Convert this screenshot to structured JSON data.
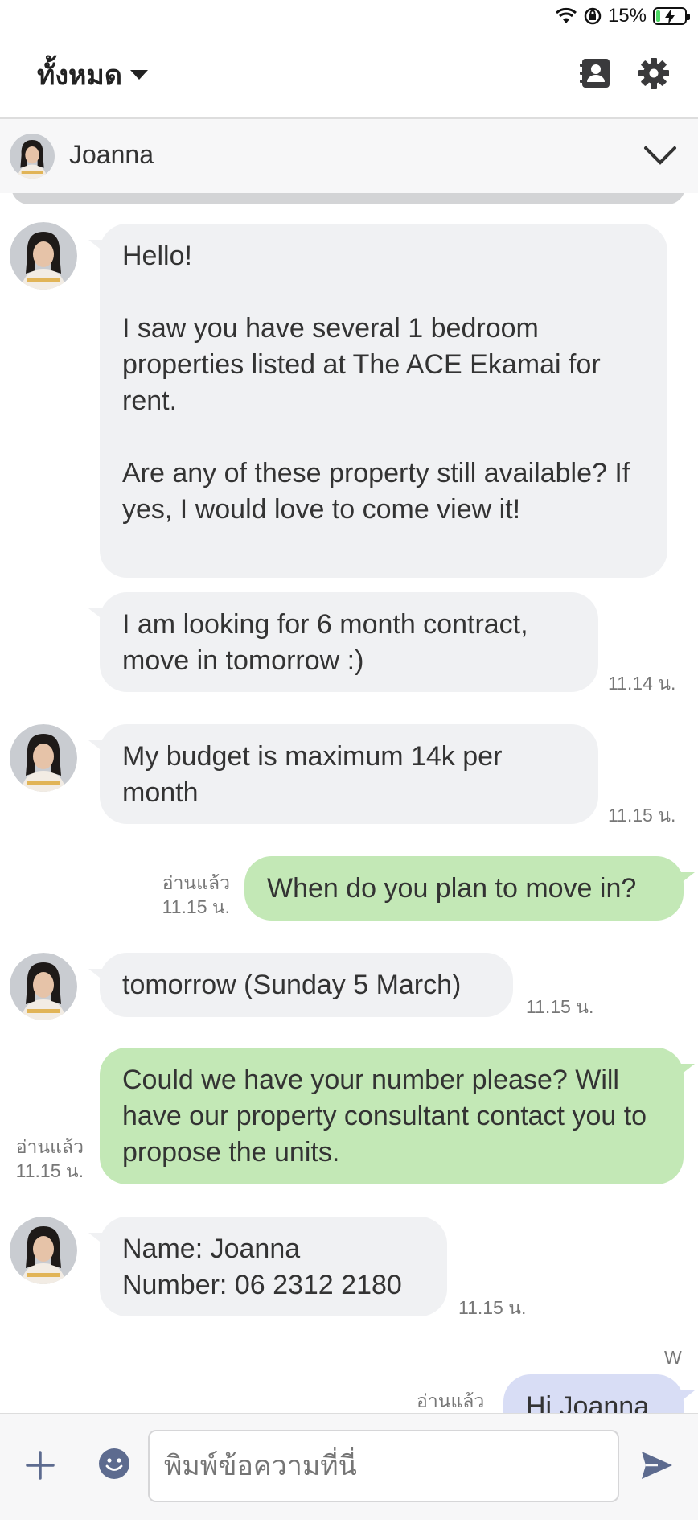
{
  "status_bar": {
    "battery": "15%",
    "battery_level": 0.15,
    "icons": [
      "wifi-icon",
      "rotation-lock-icon",
      "battery-charging-icon"
    ]
  },
  "header": {
    "filter_label": "ทั้งหมด",
    "icons": [
      "contact-card-icon",
      "gear-icon"
    ]
  },
  "contact": {
    "name": "Joanna"
  },
  "messages": [
    {
      "side": "in",
      "text": "Hello!\n\nI saw you have several 1 bedroom properties listed at The ACE Ekamai for rent.\n\nAre any of these property still available? If yes, I would love to come view it!"
    },
    {
      "side": "in",
      "text": "I am looking for 6 month contract, move in tomorrow :)",
      "time": "11.14 น."
    },
    {
      "side": "in",
      "text": "My budget is maximum 14k per month",
      "time": "11.15 น."
    },
    {
      "side": "out",
      "text": "When do you plan to move in?",
      "read": "อ่านแล้ว",
      "time": "11.15 น."
    },
    {
      "side": "in",
      "text": "tomorrow (Sunday 5 March)",
      "time": "11.15 น."
    },
    {
      "side": "out",
      "text": "Could we have your number please? Will have our property consultant contact you to propose the units.",
      "read": "อ่านแล้ว",
      "time": "11.15 น."
    },
    {
      "side": "in",
      "text": "Name: Joanna\nNumber: 06 2312 2180",
      "time": "11.15 น."
    },
    {
      "side": "out",
      "text": "Hi Joanna",
      "sender_label": "W",
      "read": "อ่านแล้ว"
    }
  ],
  "input": {
    "placeholder": "พิมพ์ข้อความที่นี่"
  },
  "colors": {
    "incoming_bubble": "#f0f1f3",
    "outgoing_bubble": "#c3e8b6",
    "outgoing_bubble_alt": "#d8ddf5",
    "send_icon": "#5d6b8f"
  }
}
